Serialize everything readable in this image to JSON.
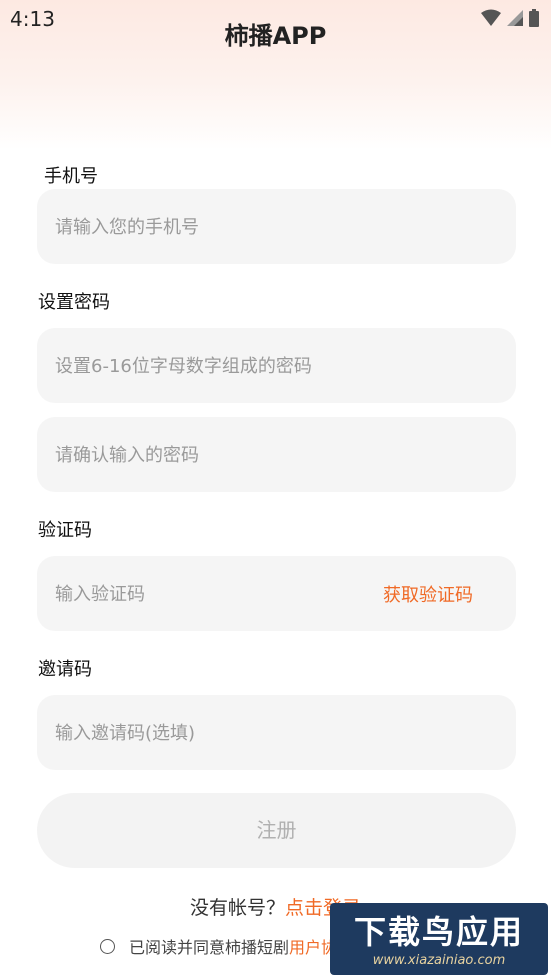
{
  "status_bar": {
    "time": "4:13"
  },
  "header": {
    "title": "柿播APP"
  },
  "form": {
    "phone": {
      "label": "手机号",
      "placeholder": "请输入您的手机号"
    },
    "password": {
      "label": "设置密码",
      "placeholder": "设置6-16位字母数字组成的密码",
      "confirm_placeholder": "请确认输入的密码"
    },
    "code": {
      "label": "验证码",
      "placeholder": "输入验证码",
      "get_code": "获取验证码"
    },
    "invite": {
      "label": "邀请码",
      "placeholder": "输入邀请码(选填)"
    },
    "submit": "注册"
  },
  "footer": {
    "no_account": "没有帐号？",
    "login_link": "点击登录",
    "agree_text": "已阅读并同意柿播短剧",
    "agreement_link": "用户协议"
  },
  "watermark": {
    "big": "下载鸟应用",
    "small": "www.xiazainiao.com"
  },
  "colors": {
    "accent": "#f06a26",
    "field_bg": "#f5f5f5"
  },
  "icons": [
    "wifi-icon",
    "signal-icon",
    "battery-icon"
  ]
}
